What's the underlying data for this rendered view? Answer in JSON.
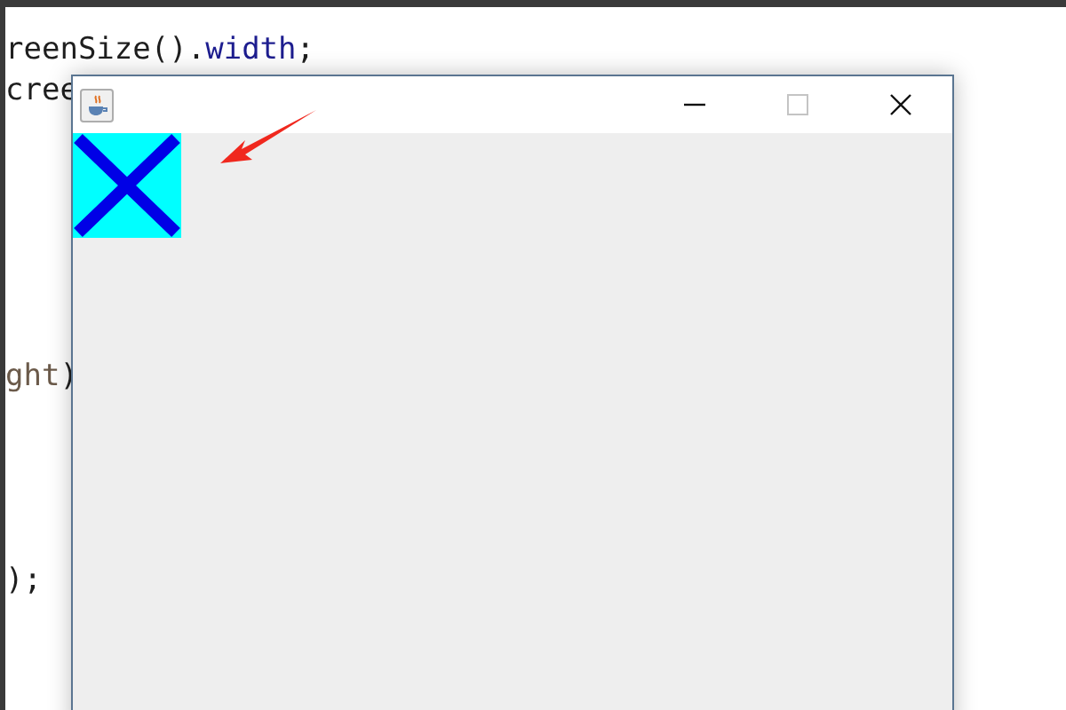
{
  "editor": {
    "lines": [
      {
        "segments": [
          {
            "kind": "plain",
            "text": "reenSize()."
          },
          {
            "kind": "field",
            "text": "width"
          },
          {
            "kind": "plain",
            "text": ";"
          }
        ]
      },
      {
        "segments": [
          {
            "kind": "plain",
            "text": "cree"
          }
        ]
      },
      {
        "segments": [
          {
            "kind": "variable",
            "text": "ght"
          },
          {
            "kind": "plain",
            "text": ")"
          }
        ]
      },
      {
        "segments": [
          {
            "kind": "plain",
            "text": ");"
          }
        ]
      }
    ]
  },
  "window": {
    "controls": [
      {
        "kind": "minimize",
        "disabled": false
      },
      {
        "kind": "maximize",
        "disabled": true
      },
      {
        "kind": "close",
        "disabled": false
      }
    ]
  }
}
